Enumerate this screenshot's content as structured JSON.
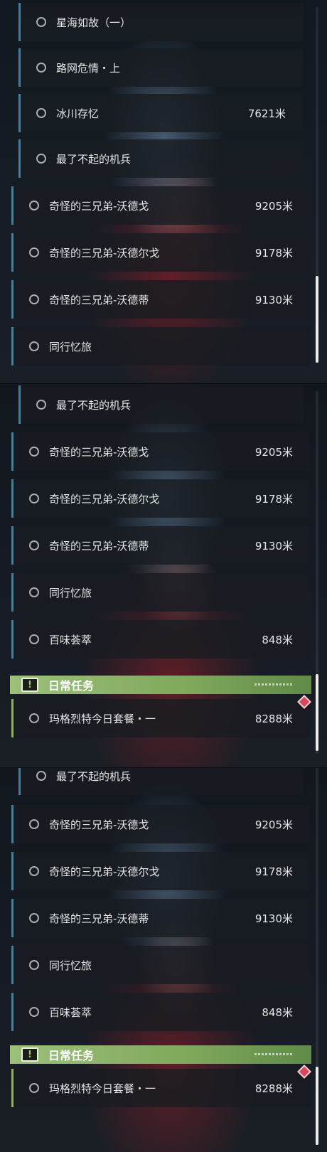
{
  "daily_section_label": "日常任务",
  "daily_section_icon": "exclamation-icon",
  "panels": [
    {
      "rows": [
        {
          "title": "星海如故（一）",
          "distance": ""
        },
        {
          "title": "路网危情・上",
          "distance": ""
        },
        {
          "title": "冰川存忆",
          "distance": "7621米"
        },
        {
          "title": "最了不起的机兵",
          "distance": ""
        },
        {
          "title": "奇怪的三兄弟-沃德戈",
          "distance": "9205米"
        },
        {
          "title": "奇怪的三兄弟-沃德尔戈",
          "distance": "9178米"
        },
        {
          "title": "奇怪的三兄弟-沃德蒂",
          "distance": "9130米"
        },
        {
          "title": "同行忆旅",
          "distance": ""
        }
      ]
    },
    {
      "rows": [
        {
          "title": "最了不起的机兵",
          "distance": ""
        },
        {
          "title": "奇怪的三兄弟-沃德戈",
          "distance": "9205米"
        },
        {
          "title": "奇怪的三兄弟-沃德尔戈",
          "distance": "9178米"
        },
        {
          "title": "奇怪的三兄弟-沃德蒂",
          "distance": "9130米"
        },
        {
          "title": "同行忆旅",
          "distance": ""
        },
        {
          "title": "百味荟萃",
          "distance": "848米"
        }
      ],
      "daily_rows": [
        {
          "title": "玛格烈特今日套餐・一",
          "distance": "8288米"
        }
      ]
    },
    {
      "rows": [
        {
          "title": "最了不起的机兵",
          "distance": ""
        },
        {
          "title": "奇怪的三兄弟-沃德戈",
          "distance": "9205米"
        },
        {
          "title": "奇怪的三兄弟-沃德尔戈",
          "distance": "9178米"
        },
        {
          "title": "奇怪的三兄弟-沃德蒂",
          "distance": "9130米"
        },
        {
          "title": "同行忆旅",
          "distance": ""
        },
        {
          "title": "百味荟萃",
          "distance": "848米"
        }
      ],
      "daily_rows": [
        {
          "title": "玛格烈特今日套餐・一",
          "distance": "8288米"
        }
      ]
    }
  ],
  "colors": {
    "accent_mission": "#4e7c92",
    "accent_daily": "#8fae6a",
    "marker_gem": "#d8475a"
  }
}
